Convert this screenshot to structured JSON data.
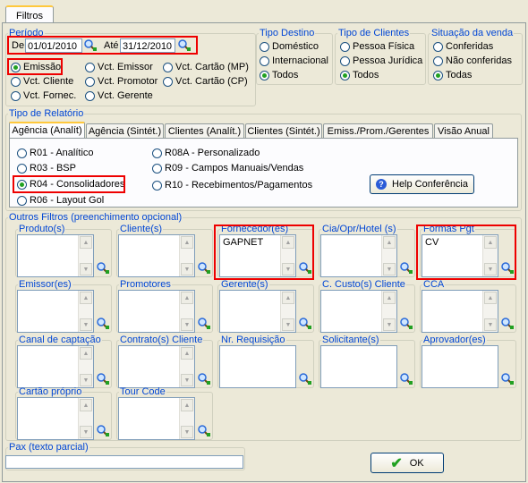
{
  "tab_title": "Filtros",
  "periodo": {
    "legend": "Período",
    "de_label": "De",
    "de_value": "01/01/2010",
    "ate_label": "Até",
    "ate_value": "31/12/2010"
  },
  "date_type": {
    "emissao": "Emissão",
    "vct_cliente": "Vct. Cliente",
    "vct_fornec": "Vct. Fornec.",
    "vct_emissor": "Vct. Emissor",
    "vct_promotor": "Vct. Promotor",
    "vct_gerente": "Vct. Gerente",
    "vct_cartao_mp": "Vct. Cartão (MP)",
    "vct_cartao_cp": "Vct. Cartão (CP)"
  },
  "tipo_destino": {
    "legend": "Tipo Destino",
    "options": [
      "Doméstico",
      "Internacional",
      "Todos"
    ],
    "selected": "Todos"
  },
  "tipo_clientes": {
    "legend": "Tipo de Clientes",
    "options": [
      "Pessoa Física",
      "Pessoa Jurídica",
      "Todos"
    ],
    "selected": "Todos"
  },
  "situacao_venda": {
    "legend": "Situação da venda",
    "options": [
      "Conferidas",
      "Não conferidas",
      "Todas"
    ],
    "selected": "Todas"
  },
  "tipo_relatorio": {
    "legend": "Tipo de Relatório",
    "tabs": [
      "Agência (Analít)",
      "Agência (Sintét.)",
      "Clientes (Analít.)",
      "Clientes (Sintét.)",
      "Emiss./Prom./Gerentes",
      "Visão Anual"
    ],
    "active_tab": "Agência (Analít)",
    "reports": [
      "R01 - Analítico",
      "R03 - BSP",
      "R04 - Consolidadores",
      "R06 - Layout Gol",
      "R08A - Personalizado",
      "R09 - Campos Manuais/Vendas",
      "R10 - Recebimentos/Pagamentos"
    ],
    "selected": "R04 - Consolidadores",
    "help_button": "Help Conferência"
  },
  "outros_filtros": {
    "legend": "Outros Filtros (preenchimento opcional)",
    "produtos": "Produto(s)",
    "clientes": "Cliente(s)",
    "fornecedor": "Fornecedor(es)",
    "fornecedor_value": "GAPNET",
    "cia": "Cia/Opr/Hotel (s)",
    "formas_pgt": "Formas Pgt",
    "formas_pgt_value": "CV",
    "emissor": "Emissor(es)",
    "promotores": "Promotores",
    "gerente": "Gerente(s)",
    "custo": "C. Custo(s) Cliente",
    "cca": "CCA",
    "canal": "Canal de captação",
    "contrato": "Contrato(s) Cliente",
    "requisicao": "Nr. Requisição",
    "solicitante": "Solicitante(s)",
    "aprovador": "Aprovador(es)",
    "cartao": "Cartão próprio",
    "tour": "Tour Code"
  },
  "pax": {
    "legend": "Pax (texto parcial)",
    "value": ""
  },
  "ok_button": "OK"
}
